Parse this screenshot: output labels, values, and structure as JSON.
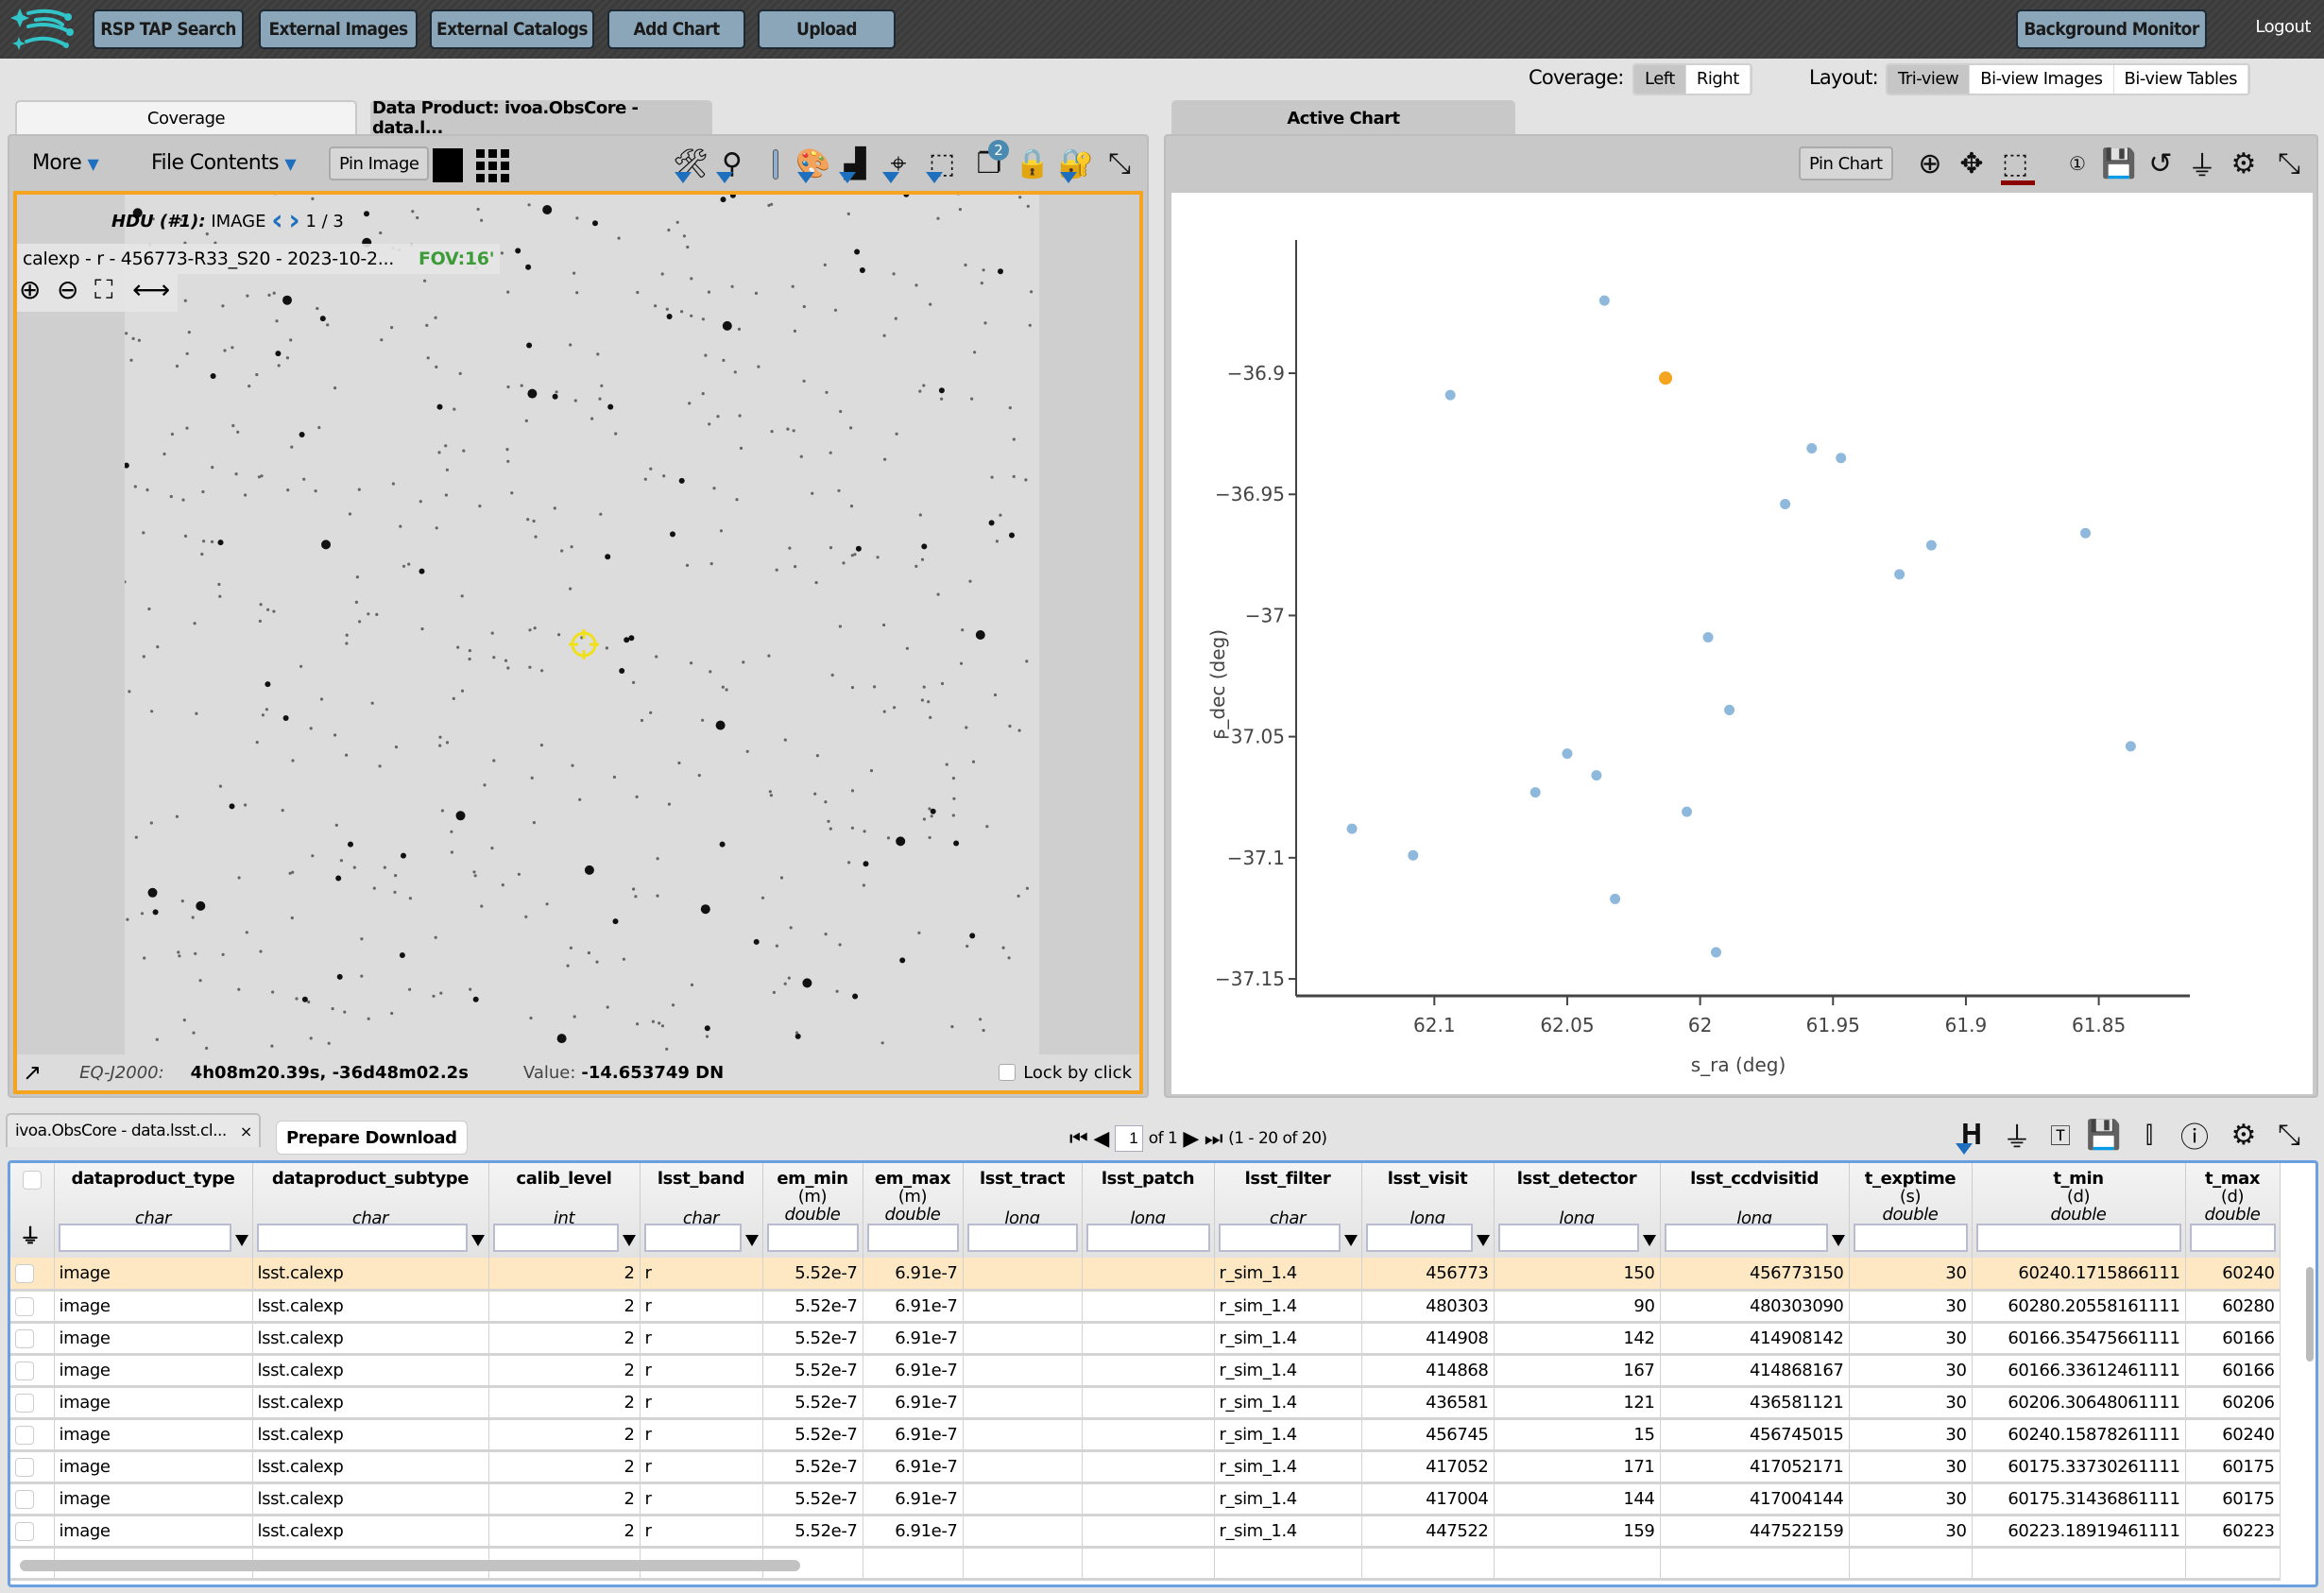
{
  "topbar": {
    "buttons": [
      "RSP TAP Search",
      "External Images",
      "External Catalogs",
      "Add Chart",
      "Upload"
    ],
    "background_monitor": "Background Monitor",
    "logout": "Logout"
  },
  "layout_controls": {
    "coverage_label": "Coverage:",
    "coverage_options": [
      "Left",
      "Right"
    ],
    "coverage_selected": "Left",
    "layout_label": "Layout:",
    "layout_options": [
      "Tri-view",
      "Bi-view Images",
      "Bi-view Tables"
    ],
    "layout_selected": "Tri-view"
  },
  "tabs": {
    "left": [
      "Coverage",
      "Data Product: ivoa.ObsCore - data.l..."
    ],
    "left_active": 1,
    "right": [
      "Active Chart"
    ]
  },
  "image_panel": {
    "more": "More",
    "file_contents": "File Contents",
    "pin_image": "Pin Image",
    "overlay_badge": "2",
    "hdu_label": "HDU (#1):",
    "hdu_type": "IMAGE",
    "hdu_page": "1 / 3",
    "image_title": "calexp - r - 456773-R33_S20 - 2023-10-2...",
    "fov": "FOV:16'",
    "coord_sys": "EQ-J2000:",
    "coords": "4h08m20.39s, -36d48m02.2s",
    "value_label": "Value:",
    "value": "-14.653749 DN",
    "lock_by_click": "Lock by click",
    "accent_color": "#f5a41f"
  },
  "chart_panel": {
    "pin_chart": "Pin Chart"
  },
  "chart_data": {
    "type": "scatter",
    "title": "",
    "xlabel": "s_ra (deg)",
    "ylabel": "s_dec (deg)",
    "x_reversed": true,
    "xlim": [
      62.152,
      61.82
    ],
    "ylim": [
      -37.157,
      -36.845
    ],
    "xticks": [
      "62.1",
      "62.05",
      "62",
      "61.95",
      "61.9",
      "61.85"
    ],
    "xtick_values": [
      62.1,
      62.05,
      62.0,
      61.95,
      61.9,
      61.85
    ],
    "yticks": [
      "−36.9",
      "−36.95",
      "−37",
      "−37.05",
      "−37.1",
      "−37.15"
    ],
    "ytick_values": [
      -36.9,
      -36.95,
      -37.0,
      -37.05,
      -37.1,
      -37.15
    ],
    "grid": false,
    "point_color": "#8fb9dc",
    "highlight_color": "#f5a41f",
    "points": [
      {
        "x": 62.036,
        "y": -36.87
      },
      {
        "x": 62.013,
        "y": -36.902,
        "highlighted": true
      },
      {
        "x": 62.094,
        "y": -36.909
      },
      {
        "x": 61.958,
        "y": -36.931
      },
      {
        "x": 61.947,
        "y": -36.935
      },
      {
        "x": 61.968,
        "y": -36.954
      },
      {
        "x": 61.855,
        "y": -36.966
      },
      {
        "x": 61.913,
        "y": -36.971
      },
      {
        "x": 61.925,
        "y": -36.983
      },
      {
        "x": 61.997,
        "y": -37.009
      },
      {
        "x": 61.989,
        "y": -37.039
      },
      {
        "x": 61.838,
        "y": -37.054
      },
      {
        "x": 62.05,
        "y": -37.057
      },
      {
        "x": 62.039,
        "y": -37.066
      },
      {
        "x": 62.062,
        "y": -37.073
      },
      {
        "x": 62.005,
        "y": -37.081
      },
      {
        "x": 62.131,
        "y": -37.088
      },
      {
        "x": 62.108,
        "y": -37.099
      },
      {
        "x": 62.032,
        "y": -37.117
      },
      {
        "x": 61.994,
        "y": -37.139
      }
    ]
  },
  "table": {
    "tab_label": "ivoa.ObsCore - data.lsst.cl...",
    "prepare_download": "Prepare Download",
    "page": "1",
    "of_pages": "of 1",
    "range": "(1 - 20 of 20)",
    "columns": [
      {
        "name": "dataproduct_type",
        "unit": "",
        "type": "char",
        "dropdown": true
      },
      {
        "name": "dataproduct_subtype",
        "unit": "",
        "type": "char",
        "dropdown": true
      },
      {
        "name": "calib_level",
        "unit": "",
        "type": "int",
        "dropdown": true
      },
      {
        "name": "lsst_band",
        "unit": "",
        "type": "char",
        "dropdown": true
      },
      {
        "name": "em_min",
        "unit": "(m)",
        "type": "double",
        "dropdown": false
      },
      {
        "name": "em_max",
        "unit": "(m)",
        "type": "double",
        "dropdown": false
      },
      {
        "name": "lsst_tract",
        "unit": "",
        "type": "long",
        "dropdown": false
      },
      {
        "name": "lsst_patch",
        "unit": "",
        "type": "long",
        "dropdown": false
      },
      {
        "name": "lsst_filter",
        "unit": "",
        "type": "char",
        "dropdown": true
      },
      {
        "name": "lsst_visit",
        "unit": "",
        "type": "long",
        "dropdown": true
      },
      {
        "name": "lsst_detector",
        "unit": "",
        "type": "long",
        "dropdown": true
      },
      {
        "name": "lsst_ccdvisitid",
        "unit": "",
        "type": "long",
        "dropdown": true
      },
      {
        "name": "t_exptime",
        "unit": "(s)",
        "type": "double",
        "dropdown": false
      },
      {
        "name": "t_min",
        "unit": "(d)",
        "type": "double",
        "dropdown": false
      },
      {
        "name": "t_max",
        "unit": "(d)",
        "type": "double",
        "dropdown": false
      }
    ],
    "rows": [
      [
        "image",
        "lsst.calexp",
        "2",
        "r",
        "5.52e-7",
        "6.91e-7",
        "",
        "",
        "r_sim_1.4",
        "456773",
        "150",
        "456773150",
        "30",
        "60240.1715866111",
        "60240"
      ],
      [
        "image",
        "lsst.calexp",
        "2",
        "r",
        "5.52e-7",
        "6.91e-7",
        "",
        "",
        "r_sim_1.4",
        "480303",
        "90",
        "480303090",
        "30",
        "60280.20558161111",
        "60280"
      ],
      [
        "image",
        "lsst.calexp",
        "2",
        "r",
        "5.52e-7",
        "6.91e-7",
        "",
        "",
        "r_sim_1.4",
        "414908",
        "142",
        "414908142",
        "30",
        "60166.35475661111",
        "60166"
      ],
      [
        "image",
        "lsst.calexp",
        "2",
        "r",
        "5.52e-7",
        "6.91e-7",
        "",
        "",
        "r_sim_1.4",
        "414868",
        "167",
        "414868167",
        "30",
        "60166.33612461111",
        "60166"
      ],
      [
        "image",
        "lsst.calexp",
        "2",
        "r",
        "5.52e-7",
        "6.91e-7",
        "",
        "",
        "r_sim_1.4",
        "436581",
        "121",
        "436581121",
        "30",
        "60206.30648061111",
        "60206"
      ],
      [
        "image",
        "lsst.calexp",
        "2",
        "r",
        "5.52e-7",
        "6.91e-7",
        "",
        "",
        "r_sim_1.4",
        "456745",
        "15",
        "456745015",
        "30",
        "60240.15878261111",
        "60240"
      ],
      [
        "image",
        "lsst.calexp",
        "2",
        "r",
        "5.52e-7",
        "6.91e-7",
        "",
        "",
        "r_sim_1.4",
        "417052",
        "171",
        "417052171",
        "30",
        "60175.33730261111",
        "60175"
      ],
      [
        "image",
        "lsst.calexp",
        "2",
        "r",
        "5.52e-7",
        "6.91e-7",
        "",
        "",
        "r_sim_1.4",
        "417004",
        "144",
        "417004144",
        "30",
        "60175.31436861111",
        "60175"
      ],
      [
        "image",
        "lsst.calexp",
        "2",
        "r",
        "5.52e-7",
        "6.91e-7",
        "",
        "",
        "r_sim_1.4",
        "447522",
        "159",
        "447522159",
        "30",
        "60223.18919461111",
        "60223"
      ]
    ],
    "selected_row": 0
  }
}
